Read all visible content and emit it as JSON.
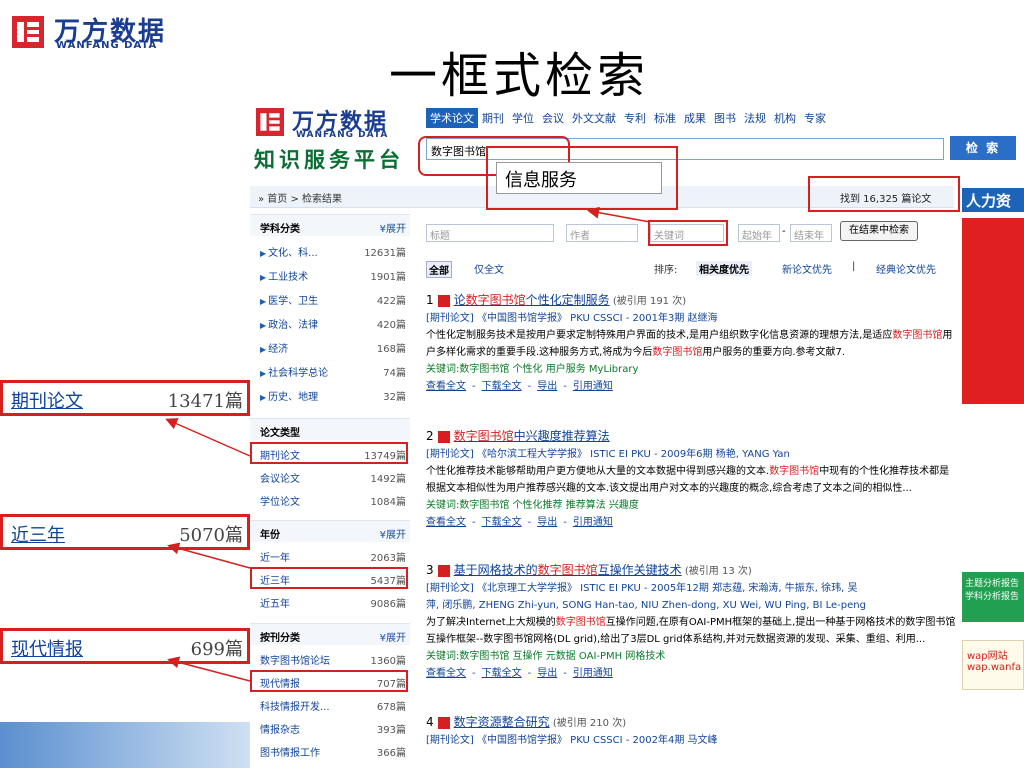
{
  "slide": {
    "logo_cn": "万方数据",
    "logo_en": "WANFANG DATA",
    "title": "一框式检索"
  },
  "site": {
    "logo_cn": "万方数据",
    "logo_en": "WANFANG DATA",
    "platform": "知识服务平台",
    "tabs": [
      "学术论文",
      "期刊",
      "学位",
      "会议",
      "外文文献",
      "专利",
      "标准",
      "成果",
      "图书",
      "法规",
      "机构",
      "专家"
    ],
    "search_value": "数字图书馆",
    "search_button": "检 索",
    "popup_text": "信息服务",
    "breadcrumb": "» 首页 >  检索结果",
    "found_text": "找到 16,325 篇论文",
    "rengli_ad": "人力资"
  },
  "sidebar": {
    "subject": {
      "heading": "学科分类",
      "more": "¥展开",
      "items": [
        {
          "label": "文化、科...",
          "count": "12631篇"
        },
        {
          "label": "工业技术",
          "count": "1901篇"
        },
        {
          "label": "医学、卫生",
          "count": "422篇"
        },
        {
          "label": "政治、法律",
          "count": "420篇"
        },
        {
          "label": "经济",
          "count": "168篇"
        },
        {
          "label": "社会科学总论",
          "count": "74篇"
        },
        {
          "label": "历史、地理",
          "count": "32篇"
        }
      ]
    },
    "type": {
      "heading": "论文类型",
      "items": [
        {
          "label": "期刊论文",
          "count": "13749篇"
        },
        {
          "label": "会议论文",
          "count": "1492篇"
        },
        {
          "label": "学位论文",
          "count": "1084篇"
        }
      ]
    },
    "year": {
      "heading": "年份",
      "more": "¥展开",
      "items": [
        {
          "label": "近一年",
          "count": "2063篇"
        },
        {
          "label": "近三年",
          "count": "5437篇"
        },
        {
          "label": "近五年",
          "count": "9086篇"
        }
      ]
    },
    "journal": {
      "heading": "按刊分类",
      "more": "¥展开",
      "items": [
        {
          "label": "数字图书馆论坛",
          "count": "1360篇"
        },
        {
          "label": "现代情报",
          "count": "707篇"
        },
        {
          "label": "科技情报开发...",
          "count": "678篇"
        },
        {
          "label": "情报杂志",
          "count": "393篇"
        },
        {
          "label": "图书情报工作",
          "count": "366篇"
        }
      ]
    }
  },
  "filters": {
    "title_ph": "标题",
    "author_ph": "作者",
    "keyword_ph": "关键词",
    "start_year_ph": "起始年",
    "dash": "-",
    "end_year_ph": "结束年",
    "search_within": "在结果中检索"
  },
  "sort": {
    "all": "全部",
    "fulltext": "仅全文",
    "label": "排序:",
    "relevance": "相关度优先",
    "newest": "新论文优先",
    "sep": "|",
    "classic": "经典论文优先"
  },
  "results": [
    {
      "num": "1",
      "title_pre": "论",
      "title_hl": "数字图书馆",
      "title_post": "个性化定制服务",
      "cite": "(被引用 191 次)",
      "meta": "[期刊论文] 《中国图书馆学报》 PKU CSSCI - 2001年3期 赵继海",
      "abstract_a": "个性化定制服务技术是按用户要求定制特殊用户界面的技术,是用户组织数字化信息资源的理想方法,是适应",
      "abstract_hl1": "数字图书馆",
      "abstract_b": "用户多样化需求的重要手段.这种服务方式,将成为今后",
      "abstract_hl2": "数字图书馆",
      "abstract_c": "用户服务的重要方向.参考文献7.",
      "keywords": "关键词:数字图书馆   个性化   用户服务   MyLibrary",
      "links": [
        "查看全文",
        "-",
        "下载全文",
        "-",
        "导出",
        "-",
        "引用通知"
      ]
    },
    {
      "num": "2",
      "title_pre": "",
      "title_hl": "数字图书馆",
      "title_post": "中兴趣度推荐算法",
      "cite": "",
      "meta": "[期刊论文] 《哈尔滨工程大学学报》 ISTIC EI PKU - 2009年6期 杨艳, YANG Yan",
      "abstract_a": "个性化推荐技术能够帮助用户更方便地从大量的文本数据中得到感兴趣的文本.",
      "abstract_hl1": "数字图书馆",
      "abstract_b": "中现有的个性化推荐技术都是根据文本相似性为用户推荐感兴趣的文本.该文提出用户对文本的兴趣度的概念,综合考虑了文本之间的相似性...",
      "abstract_hl2": "",
      "abstract_c": "",
      "keywords": "关键词:数字图书馆   个性化推荐   推荐算法   兴趣度",
      "links": [
        "查看全文",
        "-",
        "下载全文",
        "-",
        "导出",
        "-",
        "引用通知"
      ]
    },
    {
      "num": "3",
      "title_pre": "基于网格技术的",
      "title_hl": "数字图书馆",
      "title_post": "互操作关键技术",
      "cite": "(被引用 13 次)",
      "meta": "[期刊论文] 《北京理工大学学报》 ISTIC EI PKU - 2005年12期 郑志蕴, 宋瀚涛, 牛振东, 徐玮, 吴",
      "meta2": "萍, 闭乐鹏, ZHENG Zhi-yun, SONG Han-tao, NIU Zhen-dong, XU Wei, WU Ping, BI Le-peng",
      "abstract_a": "为了解决Internet上大规模的",
      "abstract_hl1": "数字图书馆",
      "abstract_b": "互操作问题,在原有OAI-PMH框架的基础上,提出一种基于网格技术的数字图书馆互操作框架--数字图书馆网格(DL grid),给出了3层DL grid体系结构,并对元数据资源的发现、采集、重组、利用...",
      "abstract_hl2": "",
      "abstract_c": "",
      "keywords": "关键词:数字图书馆   互操作   元数据   OAI-PMH   网格技术",
      "links": [
        "查看全文",
        "-",
        "下载全文",
        "-",
        "导出",
        "-",
        "引用通知"
      ]
    },
    {
      "num": "4",
      "title_pre": "数字资源整合研究",
      "title_hl": "",
      "title_post": "",
      "cite": "(被引用 210 次)",
      "meta": "[期刊论文] 《中国图书馆学报》 PKU CSSCI - 2002年4期 马文峰"
    }
  ],
  "ads": {
    "green": "主题分析报告\n学科分析报告",
    "wap": "wap网站\nwap.wanfa"
  },
  "callouts": [
    {
      "label": "期刊论文",
      "count": "13471篇"
    },
    {
      "label": "近三年",
      "count": "5070篇"
    },
    {
      "label": "现代情报",
      "count": "699篇"
    }
  ],
  "colors": {
    "accent_red": "#d42020",
    "brand_blue": "#1b3d8f",
    "link_blue": "#114499"
  }
}
